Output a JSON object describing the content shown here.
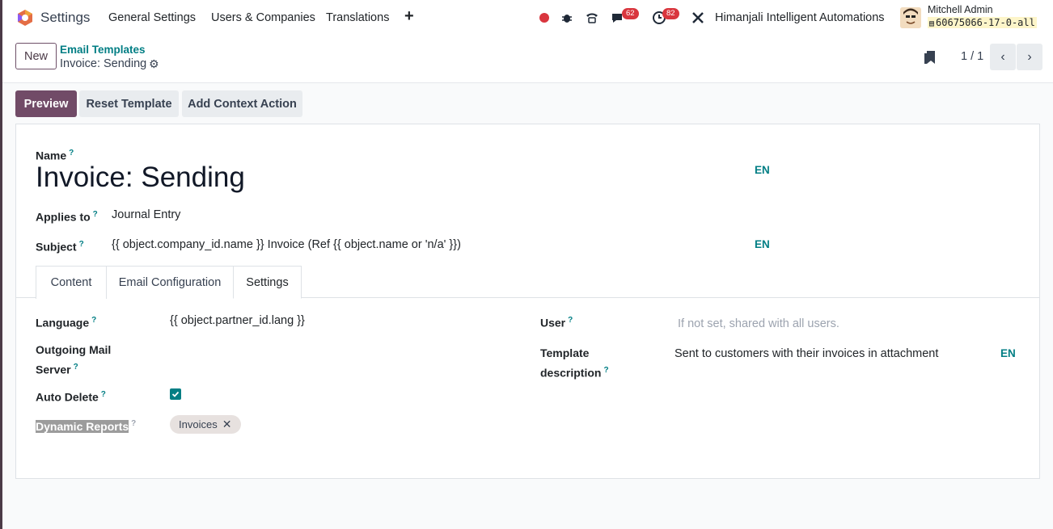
{
  "navbar": {
    "app_title": "Settings",
    "menu": [
      "General Settings",
      "Users & Companies",
      "Translations"
    ],
    "plus": "+",
    "messages_badge": "62",
    "activities_badge": "82",
    "company": "Himanjali Intelligent Automations",
    "user_name": "Mitchell Admin",
    "db_name": "60675066-17-0-all"
  },
  "control_panel": {
    "new_button": "New",
    "breadcrumb_parent": "Email Templates",
    "breadcrumb_current": "Invoice: Sending",
    "pager": "1 / 1"
  },
  "actions": {
    "preview": "Preview",
    "reset_template": "Reset Template",
    "add_context_action": "Add Context Action"
  },
  "form": {
    "name_label": "Name",
    "name_value": "Invoice: Sending",
    "lang_tag": "EN",
    "applies_to_label": "Applies to",
    "applies_to_value": "Journal Entry",
    "subject_label": "Subject",
    "subject_value": "{{ object.company_id.name }} Invoice (Ref {{ object.name or 'n/a' }})",
    "help_mark": "?"
  },
  "tabs": [
    "Content",
    "Email Configuration",
    "Settings"
  ],
  "settings_tab": {
    "language_label": "Language",
    "language_value": "{{ object.partner_id.lang }}",
    "outgoing_label_1": "Outgoing Mail",
    "outgoing_label_2": "Server",
    "auto_delete_label": "Auto Delete",
    "auto_delete_checked": true,
    "dynamic_reports_label": "Dynamic Reports",
    "dynamic_reports_tag": "Invoices",
    "user_label": "User",
    "user_placeholder": "If not set, shared with all users.",
    "template_desc_label_1": "Template",
    "template_desc_label_2": "description",
    "template_desc_value": "Sent to customers with their invoices in attachment"
  },
  "colors": {
    "brand": "#714b67",
    "accent": "#017e84",
    "badge": "#d9363e"
  }
}
